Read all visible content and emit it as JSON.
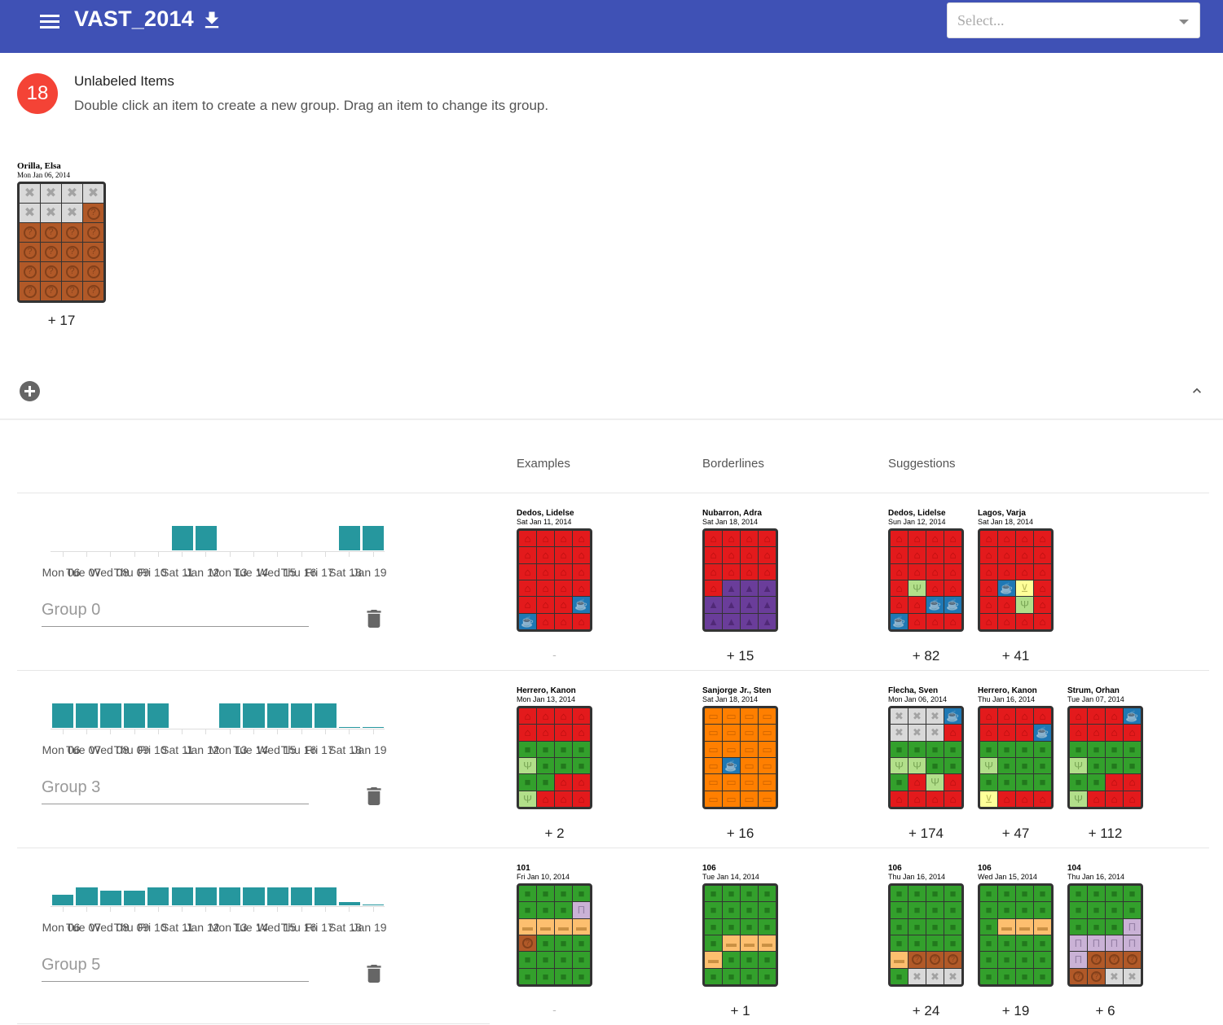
{
  "appbar": {
    "title": "VAST_2014",
    "select_placeholder": "Select...",
    "menu_icon": "menu-icon",
    "download_icon": "download-icon"
  },
  "unlabeled": {
    "badge": "18",
    "title": "Unlabeled Items",
    "help": "Double click an item to create a new group. Drag an item to change its group.",
    "card": {
      "name": "Orilla, Elsa",
      "date": "Mon Jan 06, 2014",
      "count": "+ 17",
      "cells": [
        "x",
        "x",
        "x",
        "x",
        "x",
        "x",
        "x",
        "q",
        "q",
        "q",
        "q",
        "q",
        "q",
        "q",
        "q",
        "q",
        "q",
        "q",
        "q",
        "q",
        "q",
        "q",
        "q",
        "q"
      ]
    }
  },
  "columns": {
    "examples": "Examples",
    "borderlines": "Borderlines",
    "suggestions": "Suggestions"
  },
  "colors": {
    "red": "#e31a1c",
    "green": "#33a02c",
    "orange": "#ff7f00",
    "grey": "#d9d9d9",
    "brown": "#b15928",
    "purple": "#6a3d9a",
    "blue": "#1f78b4",
    "lgreen": "#b2df8a",
    "yellow": "#ffff99",
    "peach": "#fdbf6f",
    "lavender": "#cab2d6",
    "teal": "#26979e",
    "appbar": "#3f51b5",
    "badge": "#f44336"
  },
  "histogram_axis": [
    "Mon 06",
    "Tue 07",
    "Wed 08",
    "Thu 09",
    "Fri 10",
    "Sat 11",
    "Jan 12",
    "Mon 13",
    "Tue 14",
    "Wed 15",
    "Thu 16",
    "Fri 17",
    "Sat 18",
    "Jan 19"
  ],
  "histogram_axis_shown": "Mon 06 Tue 07 Wed 08 Thu 09 Fri 10 Sat 11 Jan 12 Mon 13 Tue 14 Wed 15 Thu 16 Fri 17 Sat 18 Jan 19",
  "groups": [
    {
      "name": "Group 0",
      "histogram": [
        0,
        0,
        0,
        0,
        0,
        1,
        1,
        0,
        0,
        0,
        0,
        0,
        1,
        1
      ],
      "examples": [
        {
          "name": "Dedos, Lidelse",
          "date": "Sat Jan 11, 2014",
          "count": "-",
          "cells": [
            "home",
            "home",
            "home",
            "home",
            "home",
            "home",
            "home",
            "home",
            "home",
            "home",
            "home",
            "home",
            "home",
            "home",
            "home",
            "home",
            "home",
            "home",
            "home",
            "coffee",
            "coffee",
            "home",
            "home",
            "home"
          ]
        }
      ],
      "borderlines": [
        {
          "name": "Nubarron, Adra",
          "date": "Sat Jan 18, 2014",
          "count": "+ 15",
          "cells": [
            "home",
            "home",
            "home",
            "home",
            "home",
            "home",
            "home",
            "home",
            "home",
            "home",
            "home",
            "home",
            "home",
            "tree",
            "tree",
            "tree",
            "tree",
            "tree",
            "tree",
            "tree",
            "tree",
            "tree",
            "tree",
            "tree"
          ]
        }
      ],
      "suggestions": [
        {
          "name": "Dedos, Lidelse",
          "date": "Sun Jan 12, 2014",
          "count": "+ 82",
          "cells": [
            "home",
            "home",
            "home",
            "home",
            "home",
            "home",
            "home",
            "home",
            "home",
            "home",
            "home",
            "home",
            "home",
            "food",
            "home",
            "home",
            "home",
            "home",
            "coffee",
            "coffee",
            "coffee",
            "home",
            "home",
            "home"
          ]
        },
        {
          "name": "Lagos, Varja",
          "date": "Sat Jan 18, 2014",
          "count": "+ 41",
          "cells": [
            "home",
            "home",
            "home",
            "home",
            "home",
            "home",
            "home",
            "home",
            "home",
            "home",
            "home",
            "home",
            "home",
            "coffee",
            "shop",
            "home",
            "home",
            "home",
            "food",
            "home",
            "home",
            "home",
            "home",
            "home"
          ]
        }
      ]
    },
    {
      "name": "Group 3",
      "histogram": [
        1,
        1,
        1,
        1,
        1,
        0,
        0,
        1,
        1,
        1,
        1,
        1,
        0.05,
        0.05
      ],
      "examples": [
        {
          "name": "Herrero, Kanon",
          "date": "Mon Jan 13, 2014",
          "count": "+ 2",
          "cells": [
            "home",
            "home",
            "home",
            "home",
            "home",
            "home",
            "home",
            "home",
            "bag",
            "bag",
            "bag",
            "bag",
            "food",
            "bag",
            "bag",
            "bag",
            "bag",
            "bag",
            "home",
            "home",
            "food",
            "home",
            "home",
            "home"
          ]
        }
      ],
      "borderlines": [
        {
          "name": "Sanjorge Jr., Sten",
          "date": "Sat Jan 18, 2014",
          "count": "+ 16",
          "cells": [
            "bed",
            "bed",
            "bed",
            "bed",
            "bed",
            "bed",
            "bed",
            "bed",
            "bed",
            "bed",
            "bed",
            "bed",
            "bed",
            "coffee",
            "bed",
            "bed",
            "bed",
            "bed",
            "bed",
            "bed",
            "bed",
            "bed",
            "bed",
            "bed"
          ]
        }
      ],
      "suggestions": [
        {
          "name": "Flecha, Sven",
          "date": "Mon Jan 06, 2014",
          "count": "+ 174",
          "cells": [
            "x",
            "x",
            "x",
            "coffee",
            "x",
            "x",
            "x",
            "home",
            "bag",
            "bag",
            "bag",
            "bag",
            "food",
            "food",
            "bag",
            "bag",
            "bag",
            "home",
            "food",
            "home",
            "home",
            "home",
            "home",
            "home"
          ]
        },
        {
          "name": "Herrero, Kanon",
          "date": "Thu Jan 16, 2014",
          "count": "+ 47",
          "cells": [
            "home",
            "home",
            "home",
            "home",
            "home",
            "home",
            "home",
            "coffee",
            "bag",
            "bag",
            "bag",
            "bag",
            "food",
            "bag",
            "bag",
            "bag",
            "bag",
            "bag",
            "bag",
            "bag",
            "shop",
            "home",
            "home",
            "home"
          ]
        },
        {
          "name": "Strum, Orhan",
          "date": "Tue Jan 07, 2014",
          "count": "+ 112",
          "cells": [
            "home",
            "home",
            "home",
            "coffee",
            "home",
            "home",
            "home",
            "home",
            "bag",
            "bag",
            "bag",
            "bag",
            "food",
            "bag",
            "bag",
            "bag",
            "bag",
            "bag",
            "home",
            "home",
            "food",
            "home",
            "home",
            "home"
          ]
        }
      ]
    },
    {
      "name": "Group 5",
      "histogram": [
        0.45,
        0.75,
        0.6,
        0.6,
        0.75,
        0.75,
        0.75,
        0.75,
        0.75,
        0.75,
        0.75,
        0.75,
        0.15,
        0.03
      ],
      "examples": [
        {
          "name": "101",
          "date": "Fri Jan 10, 2014",
          "count": "-",
          "cells": [
            "bag",
            "bag",
            "bag",
            "bag",
            "bag",
            "bag",
            "bag",
            "bank",
            "truck",
            "truck",
            "truck",
            "truck",
            "q",
            "bag",
            "bag",
            "bag",
            "bag",
            "bag",
            "bag",
            "bag",
            "bag",
            "bag",
            "bag",
            "bag"
          ]
        }
      ],
      "borderlines": [
        {
          "name": "106",
          "date": "Tue Jan 14, 2014",
          "count": "+ 1",
          "cells": [
            "bag",
            "bag",
            "bag",
            "bag",
            "bag",
            "bag",
            "bag",
            "bag",
            "bag",
            "bag",
            "bag",
            "bag",
            "bag",
            "truck",
            "truck",
            "truck",
            "truck",
            "bag",
            "bag",
            "bag",
            "bag",
            "bag",
            "bag",
            "bag"
          ]
        }
      ],
      "suggestions": [
        {
          "name": "106",
          "date": "Thu Jan 16, 2014",
          "count": "+ 24",
          "cells": [
            "bag",
            "bag",
            "bag",
            "bag",
            "bag",
            "bag",
            "bag",
            "bag",
            "bag",
            "bag",
            "bag",
            "bag",
            "bag",
            "bag",
            "bag",
            "bag",
            "truck",
            "q",
            "q",
            "q",
            "bag",
            "x",
            "x",
            "x"
          ]
        },
        {
          "name": "106",
          "date": "Wed Jan 15, 2014",
          "count": "+ 19",
          "cells": [
            "bag",
            "bag",
            "bag",
            "bag",
            "bag",
            "bag",
            "bag",
            "bag",
            "bag",
            "truck",
            "truck",
            "truck",
            "bag",
            "bag",
            "bag",
            "bag",
            "bag",
            "bag",
            "bag",
            "bag",
            "bag",
            "bag",
            "bag",
            "bag"
          ]
        },
        {
          "name": "104",
          "date": "Thu Jan 16, 2014",
          "count": "+ 6",
          "cells": [
            "bag",
            "bag",
            "bag",
            "bag",
            "bag",
            "bag",
            "bag",
            "bag",
            "bag",
            "bag",
            "bag",
            "bank",
            "bank",
            "bank",
            "bank",
            "bank",
            "bank",
            "q",
            "q",
            "q",
            "q",
            "q",
            "x",
            "x"
          ]
        }
      ]
    }
  ]
}
